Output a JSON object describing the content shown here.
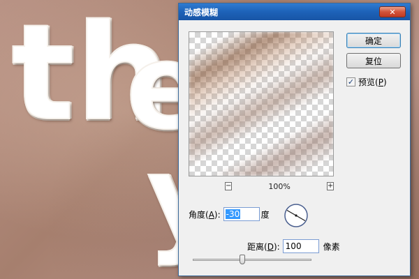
{
  "background": {
    "letters": [
      "t",
      "h",
      "e",
      "y"
    ]
  },
  "dialog": {
    "title": "动感模糊",
    "close_glyph": "✕",
    "preview_zoom": "100%",
    "zoom_out_glyph": "−",
    "zoom_in_glyph": "+",
    "ok_label": "确定",
    "reset_label": "复位",
    "preview_check": {
      "label_prefix": "预览(",
      "hotkey": "P",
      "label_suffix": ")",
      "checked": true,
      "check_glyph": "✓"
    },
    "angle": {
      "label_prefix": "角度(",
      "hotkey": "A",
      "label_suffix": "):",
      "value": "-30",
      "unit": "度"
    },
    "distance": {
      "label_prefix": "距离(",
      "hotkey": "D",
      "label_suffix": "):",
      "value": "100",
      "unit": "像素"
    },
    "distance_slider_fraction": 0.42
  },
  "colors": {
    "titlebar": "#1d62b8",
    "selection": "#3399ff",
    "chocolate": "#6b3a24"
  }
}
